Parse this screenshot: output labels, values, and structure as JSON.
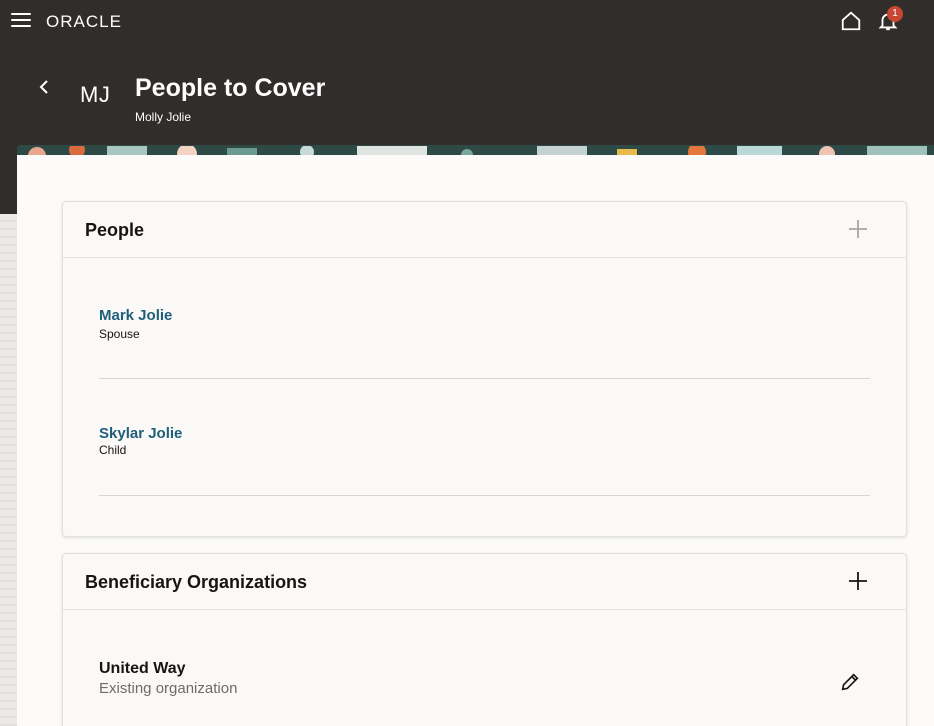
{
  "topbar": {
    "logo": "ORACLE",
    "notification_count": "1"
  },
  "header": {
    "avatar_initials": "MJ",
    "title": "People to Cover",
    "subtitle": "Molly Jolie"
  },
  "people": {
    "title": "People",
    "items": [
      {
        "name": "Mark Jolie",
        "relationship": "Spouse"
      },
      {
        "name": "Skylar Jolie",
        "relationship": "Child"
      }
    ]
  },
  "organizations": {
    "title": "Beneficiary Organizations",
    "items": [
      {
        "name": "United Way",
        "description": "Existing organization"
      }
    ]
  },
  "colors": {
    "header_bg": "#312d2a",
    "link": "#1f5f7a",
    "badge": "#c74634"
  },
  "icons": [
    "menu-icon",
    "home-icon",
    "bell-icon",
    "back-icon",
    "plus-icon",
    "pencil-icon"
  ]
}
